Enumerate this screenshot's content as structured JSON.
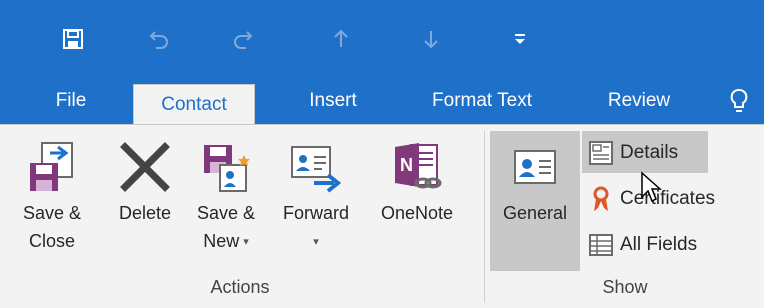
{
  "quick_access": {
    "icons": [
      "save-icon",
      "undo-icon",
      "redo-icon",
      "up-arrow-icon",
      "down-arrow-icon",
      "customize-icon"
    ]
  },
  "tabs": [
    {
      "label": "File",
      "active": false
    },
    {
      "label": "Contact",
      "active": true
    },
    {
      "label": "Insert",
      "active": false
    },
    {
      "label": "Format Text",
      "active": false
    },
    {
      "label": "Review",
      "active": false
    }
  ],
  "ribbon": {
    "actions": {
      "group_label": "Actions",
      "save_close": {
        "line1": "Save &",
        "line2": "Close"
      },
      "delete": {
        "label": "Delete"
      },
      "save_new": {
        "line1": "Save &",
        "line2": "New"
      },
      "forward": {
        "label": "Forward"
      },
      "onenote": {
        "label": "OneNote"
      }
    },
    "show": {
      "group_label": "Show",
      "general": {
        "label": "General"
      },
      "details": {
        "label": "Details"
      },
      "certificates": {
        "label": "Certificates"
      },
      "all_fields": {
        "label": "All Fields"
      }
    }
  },
  "colors": {
    "brand_blue": "#1e70c8",
    "ribbon_bg": "#f3f3f3",
    "selected_gray": "#c8c8c8",
    "onenote_purple": "#80397b"
  }
}
